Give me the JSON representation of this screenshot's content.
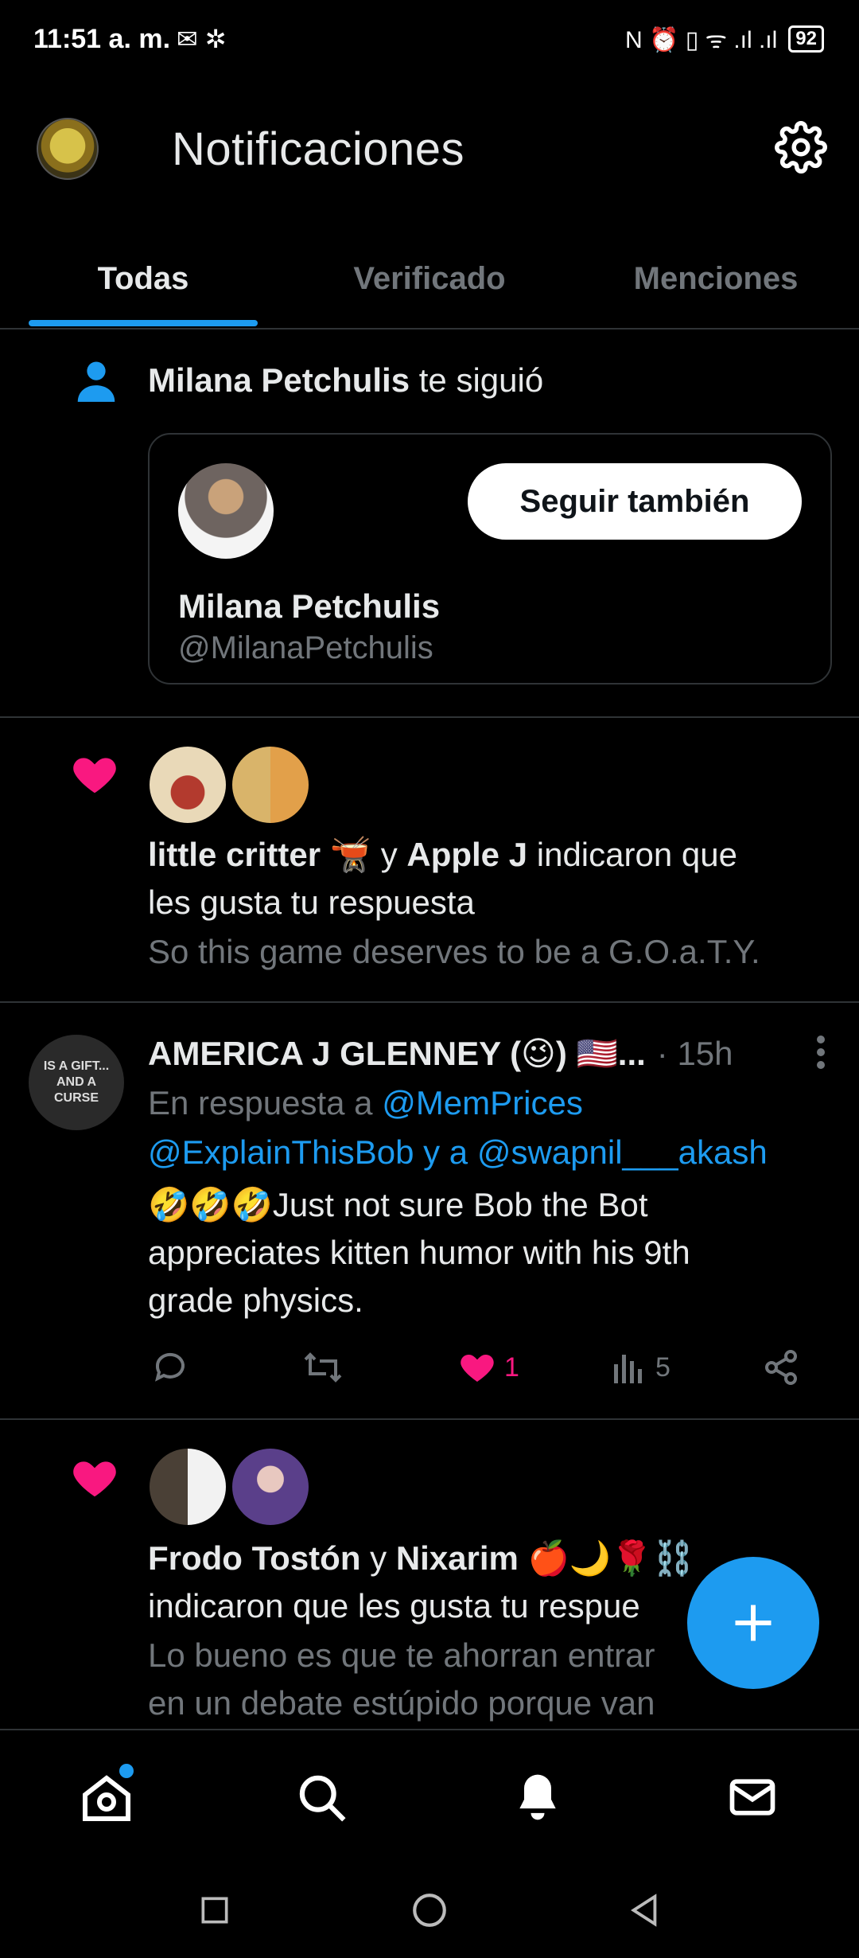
{
  "status_bar": {
    "time": "11:51 a. m.",
    "left_icons": "✉ ✲",
    "right_icons": "N ⏰ ▯ ᯤ .ıl .ıl",
    "battery": "92"
  },
  "header": {
    "title": "Notificaciones"
  },
  "tabs": [
    {
      "label": "Todas"
    },
    {
      "label": "Verificado"
    },
    {
      "label": "Menciones"
    }
  ],
  "follow_notif": {
    "name": "Milana Petchulis",
    "action_text": "te siguió",
    "card_name": "Milana Petchulis",
    "card_handle": "@MilanaPetchulis",
    "button": "Seguir también"
  },
  "like_notif_1": {
    "user1": "little critter 🫕",
    "connector": "y",
    "user2": "Apple J",
    "action_text": "indicaron que",
    "action_text2": "les gusta tu respuesta",
    "preview": "So this game deserves to be a G.O.a.T.Y."
  },
  "reply": {
    "author": "AMERICA J GLENNEY (😉) 🇺🇸...",
    "time": "· 15h",
    "reply_prefix": "En respuesta a",
    "reply_user1": "@MemPrices",
    "reply_user2": "@ExplainThisBob",
    "reply_conn": "y a",
    "reply_user3": "@swapnil___akash",
    "text_line1": "🤣🤣🤣Just not sure Bob the Bot",
    "text_line2": "appreciates kitten humor with his 9th",
    "text_line3": "grade physics.",
    "likes": "1",
    "views": "5",
    "avatar_text": "IS A GIFT... AND A CURSE"
  },
  "like_notif_2": {
    "user1": "Frodo Tostón",
    "connector": "y",
    "user2": "Nixarim 🍎🌙🌹⛓️",
    "line2": "indicaron que les gusta tu respue",
    "preview1": "Lo bueno es que te ahorran entrar",
    "preview2": "en un debate estúpido porque van"
  },
  "colors": {
    "accent": "#1d9bf0",
    "like": "#f91880",
    "muted": "#71767b",
    "text": "#e7e9ea",
    "border": "#2f3336"
  }
}
